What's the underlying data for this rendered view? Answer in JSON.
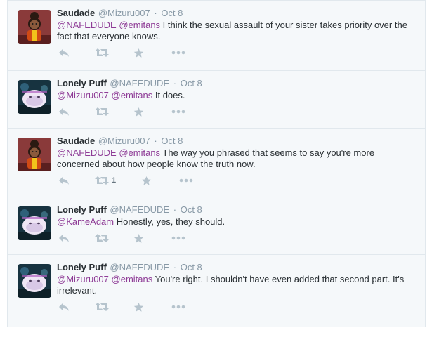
{
  "tweets": [
    {
      "fullname": "Saudade",
      "username": "@Mizuru007",
      "dot": "·",
      "time": "Oct 8",
      "avatar": "saudade",
      "mentions": [
        "@NAFEDUDE",
        "@emitans"
      ],
      "text": " I think the sexual assault of your sister takes priority over the fact that everyone knows.",
      "retweets": ""
    },
    {
      "fullname": "Lonely Puff",
      "username": "@NAFEDUDE",
      "dot": "·",
      "time": "Oct 8",
      "avatar": "puff",
      "mentions": [
        "@Mizuru007",
        "@emitans"
      ],
      "text": " It does.",
      "retweets": ""
    },
    {
      "fullname": "Saudade",
      "username": "@Mizuru007",
      "dot": "·",
      "time": "Oct 8",
      "avatar": "saudade",
      "mentions": [
        "@NAFEDUDE",
        "@emitans"
      ],
      "text": " The way you phrased that seems to say you're more concerned about how people know the truth now.",
      "retweets": "1"
    },
    {
      "fullname": "Lonely Puff",
      "username": "@NAFEDUDE",
      "dot": "·",
      "time": "Oct 8",
      "avatar": "puff",
      "mentions": [
        "@KameAdam"
      ],
      "text": " Honestly, yes, they should.",
      "retweets": ""
    },
    {
      "fullname": "Lonely Puff",
      "username": "@NAFEDUDE",
      "dot": "·",
      "time": "Oct 8",
      "avatar": "puff",
      "mentions": [
        "@Mizuru007",
        "@emitans"
      ],
      "text": " You're right. I shouldn't have even added that second part. It's irrelevant.",
      "retweets": ""
    }
  ],
  "icons": {
    "reply": "reply-icon",
    "retweet": "retweet-icon",
    "favorite": "star-icon",
    "more": "more-icon"
  },
  "colors": {
    "mention": "#8e3b96",
    "meta": "#8899a6",
    "action_icon": "#b6c4cd",
    "background": "#f5f8fa"
  }
}
